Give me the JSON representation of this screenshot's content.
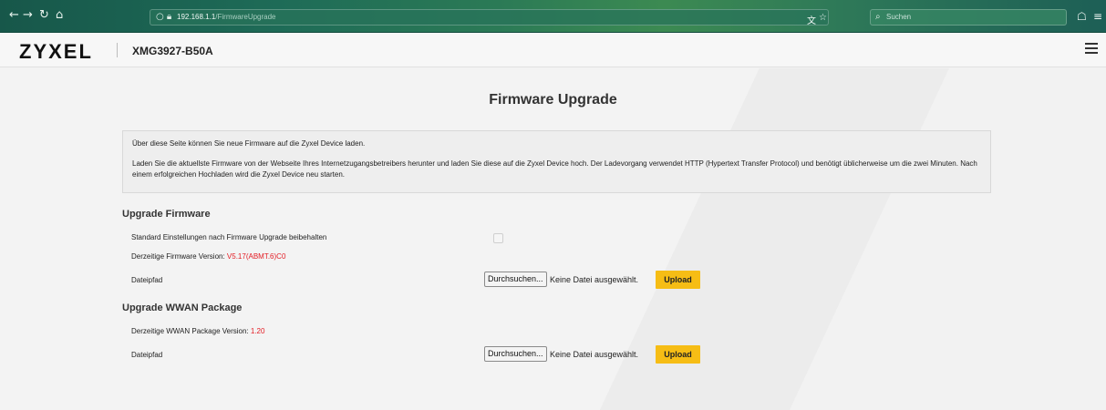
{
  "browser": {
    "url_host": "192.168.1.1",
    "url_path": "/FirmwareUpgrade",
    "search_placeholder": "Suchen"
  },
  "header": {
    "logo": "ZYXEL",
    "model": "XMG3927-B50A"
  },
  "page": {
    "title": "Firmware Upgrade",
    "info_line1": "Über diese Seite können Sie neue Firmware auf die Zyxel Device laden.",
    "info_line2": "Laden Sie die aktuellste Firmware von der Webseite Ihres Internetzugangsbetreibers herunter und laden Sie diese auf die Zyxel Device hoch. Der Ladevorgang verwendet HTTP (Hypertext Transfer Protocol) und benötigt üblicherweise um die zwei Minuten. Nach einem erfolgreichen Hochladen wird die Zyxel Device neu starten."
  },
  "firmware": {
    "section_title": "Upgrade Firmware",
    "keep_settings_label": "Standard Einstellungen nach Firmware Upgrade beibehalten",
    "keep_settings_checked": false,
    "version_label": "Derzeitige Firmware Version: ",
    "version_value": "V5.17(ABMT.6)C0",
    "path_label": "Dateipfad",
    "browse_label": "Durchsuchen...",
    "no_file_label": "Keine Datei ausgewählt.",
    "upload_label": "Upload"
  },
  "wwan": {
    "section_title": "Upgrade WWAN Package",
    "version_label": "Derzeitige WWAN Package Version: ",
    "version_value": "1.20",
    "path_label": "Dateipfad",
    "browse_label": "Durchsuchen...",
    "no_file_label": "Keine Datei ausgewählt.",
    "upload_label": "Upload"
  },
  "colors": {
    "accent_upload": "#f6bd15",
    "version_value": "#e31b23"
  }
}
